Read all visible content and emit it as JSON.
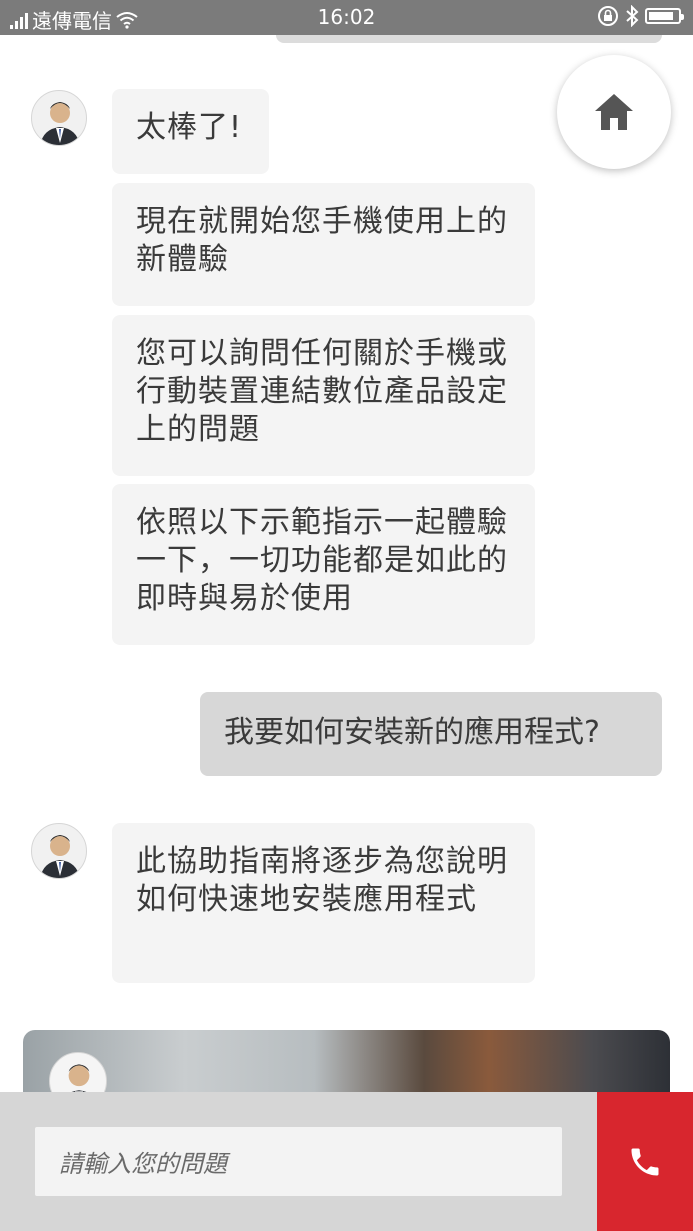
{
  "status_bar": {
    "carrier": "遠傳電信",
    "time": "16:02",
    "battery_level": 0.85,
    "icons": [
      "signal-icon",
      "wifi-icon",
      "rotation-lock-icon",
      "bluetooth-icon",
      "battery-icon"
    ]
  },
  "home_button": {
    "icon": "home-icon"
  },
  "messages": {
    "bot_intro": [
      "太棒了!",
      "現在就開始您手機使用上的新體驗",
      "您可以詢問任何關於手機或行動裝置連結數位產品設定上的問題",
      "依照以下示範指示一起體驗一下，一切功能都是如此的即時與易於使用"
    ],
    "user": "我要如何安裝新的應用程式?",
    "bot_reply": "此協助指南將逐步為您說明如何快速地安裝應用程式"
  },
  "input": {
    "placeholder": "請輸入您的問題"
  },
  "call_button": {
    "icon": "phone-icon",
    "color": "#d8262e"
  }
}
